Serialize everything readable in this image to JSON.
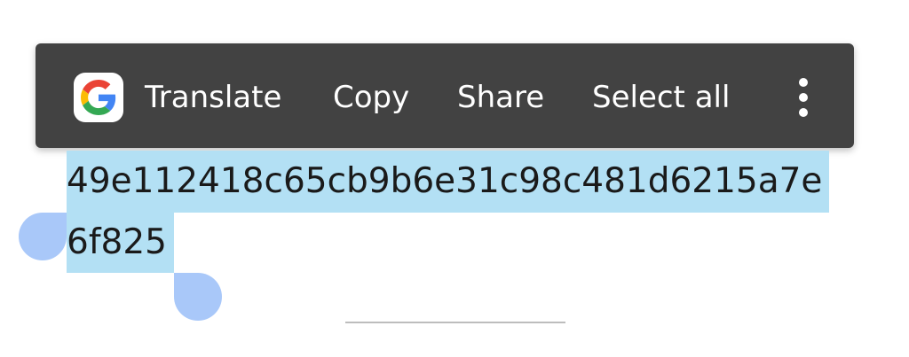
{
  "toolbar": {
    "logo_icon": "google-g-icon",
    "translate_label": "Translate",
    "copy_label": "Copy",
    "share_label": "Share",
    "select_all_label": "Select all",
    "overflow_icon": "more-vert-icon",
    "background_color": "#424242"
  },
  "selection": {
    "line1": "49e112418c65cb9b6e31c98c481d6215a7e",
    "line2": "6f825",
    "highlight_color": "#b3e0f4",
    "handle_color": "#a9c8f9"
  }
}
